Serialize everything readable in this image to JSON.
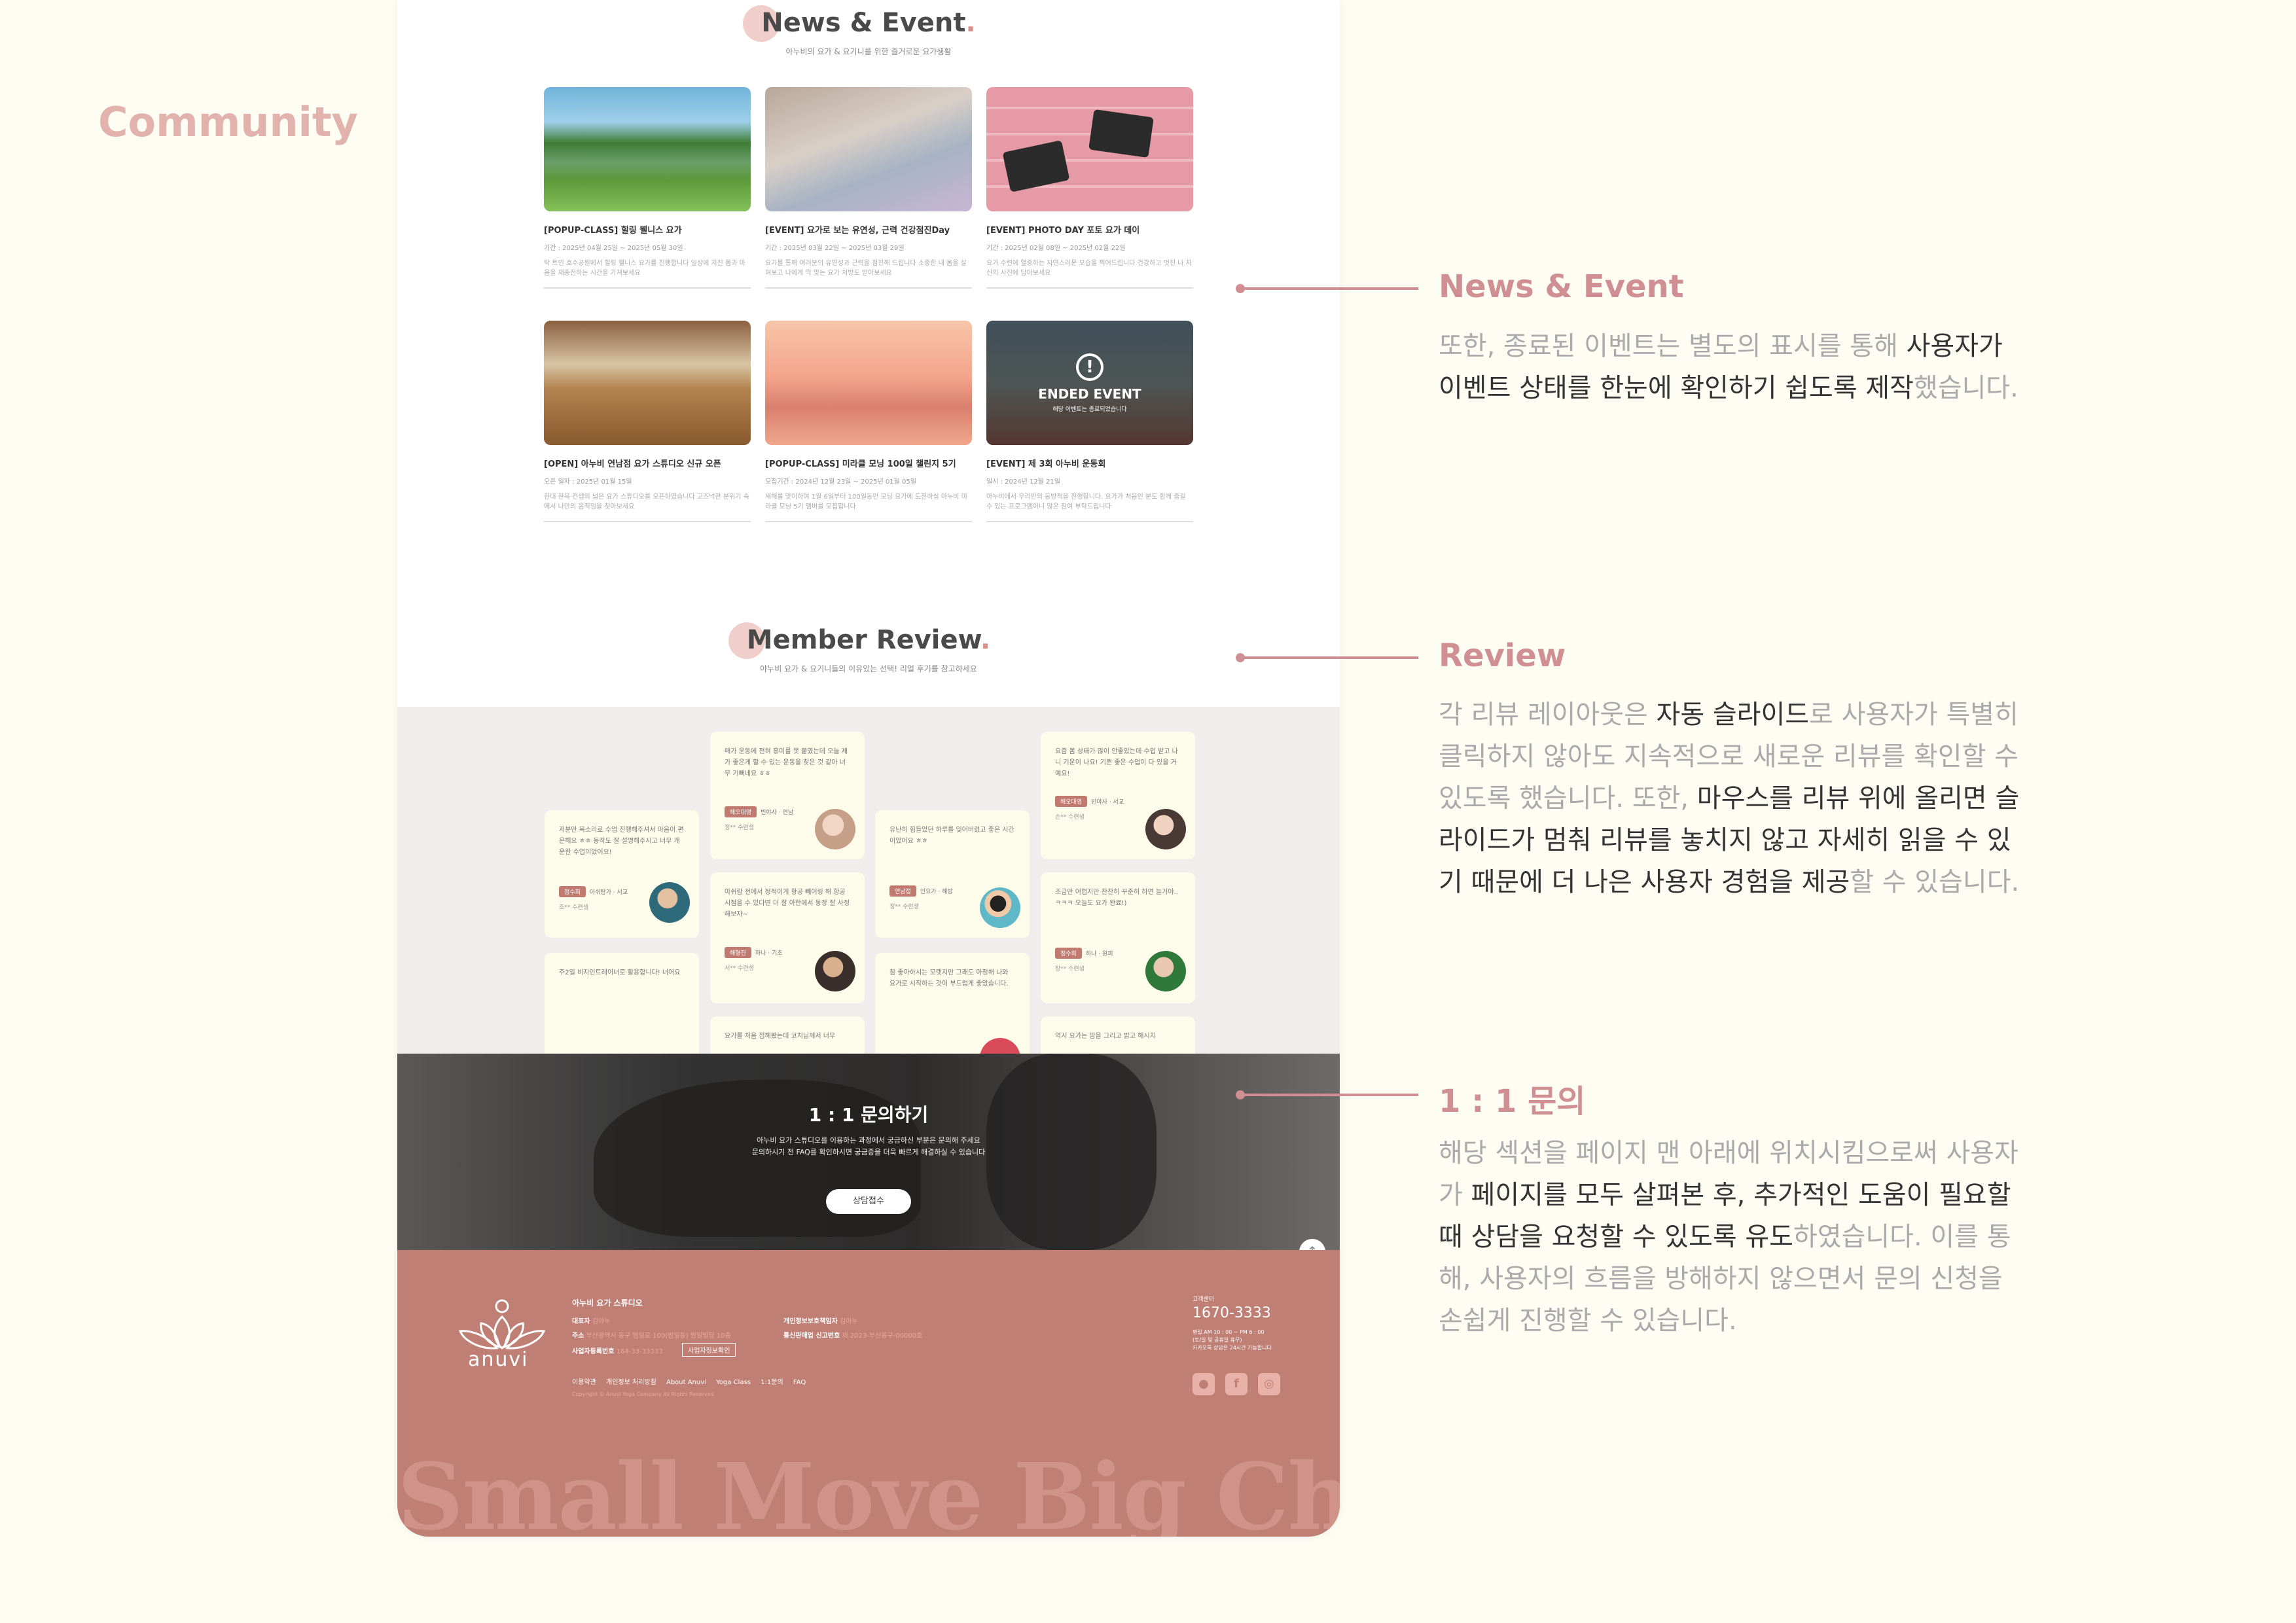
{
  "side_title": "Community",
  "news": {
    "title": "News & Event",
    "dot": ".",
    "subtitle": "아누비의 요가 & 요기니를 위한 즐거로운 요가생활",
    "cards": [
      {
        "title": "[POPUP-CLASS] 힐링 웰니스 요가",
        "date": "기간 : 2025년 04월 25일 ~ 2025년 05월 30일",
        "desc": "탁 트인 호수공원에서 힐링 웰니스 요가를 진행합니다 일상에 지친 몸과 마음을 재충전하는 시간을 가져보세요"
      },
      {
        "title": "[EVENT] 요가로 보는 유연성, 근력 건강점진Day",
        "date": "기간 : 2025년 03월 22일 ~ 2025년 03월 29일",
        "desc": "요가를 통해 여러분의 유연성과 근력을 점진해 드립니다 소중한 내 몸을 살펴보고 나에게 딱 맞는 요가 처방도 받아보세요"
      },
      {
        "title": "[EVENT] PHOTO DAY 포토 요가 데이",
        "date": "기간 : 2025년 02월 08일 ~ 2025년 02월 22일",
        "desc": "요가 수련에 열중하는 자연스러운 모습을 찍어드립니다 건강하고 멋진 나 자신의 사진에 담아보세요"
      },
      {
        "title": "[OPEN] 아누비 연남점 요가 스튜디오 신규 오픈",
        "date": "오픈 일자 : 2025년 01월 15일",
        "desc": "현대 한옥 컨셉의 넓은 요가 스튜디오를 오픈하였습니다 고즈넉한 분위기 속에서 나만의 움직임을 찾아보세요"
      },
      {
        "title": "[POPUP-CLASS] 미라클 모닝 100일 챌린지 5기",
        "date": "모집기간 : 2024년 12월 23일 ~ 2025년 01월 05일",
        "desc": "새해를 맞이하여 1월 6일부터 100일동안 모닝 요가에 도전하실 아누비 미라클 모닝 5기 멤버를 모집합니다"
      },
      {
        "title": "[EVENT] 제 3회 아누비 운동회",
        "date": "일시 : 2024년 12월 21일",
        "desc": "아누비에서 우리만의 동방적을 진행합니다. 요가가 처음인 분도 함께 즐길 수 있는 프로그램이니 많은 참여 부탁드립니다"
      }
    ],
    "ended_title": "ENDED EVENT",
    "ended_sub": "해당 이벤트는 종료되었습니다"
  },
  "review": {
    "title": "Member Review",
    "dot": ".",
    "subtitle": "아누비 요가 & 요기니들의 이유있는 선택! 리얼 후기를 참고하세요",
    "cards": [
      {
        "text": "저분만 목소리로 수업 진행해주셔서 마음이 편온해요 ㅎㅎ 동작도 잘 설명해주시고 너무 개운한 수업이었어요!",
        "tag": "정수희",
        "meta": "아쉬탕가 · 서교",
        "star": "조** 수련생"
      },
      {
        "text": "주2일 비지인트레이너로 활용합니다! 너어요",
        "tag": "",
        "meta": "",
        "star": ""
      },
      {
        "text": "매가 운동에 전혀 흥미를 못 붙였는데 오늘 제가 좋은게 할 수 있는 운동을 찾은 것 같아 너무 기뻐네요 ㅎㅎ",
        "tag": "해오대영",
        "meta": "빈야사 · 연남",
        "star": "정** 수련생"
      },
      {
        "text": "아쉬람 전에서 정적이게 항공 빼어링 해 항공 시점을 수 있다면 더 잘 아한에서 동장 잘 사정해보자~",
        "tag": "해형진",
        "meta": "하나 · 기초",
        "star": "서** 수련생"
      },
      {
        "text": "요가를 처음 접해봤는데 코치님께서 너무",
        "tag": "",
        "meta": "",
        "star": ""
      },
      {
        "text": "유난히 힘들었던 하루를 잊어버렸고 좋은 시간이었어요 ㅎㅎ",
        "tag": "연남점",
        "meta": "인요가 · 해방",
        "star": "정** 수련생"
      },
      {
        "text": "참 좋아하시는 모랫지만 그래도 아정해 나와 요가로 시작하는 것이 부드럽게 좋았습니다.",
        "tag": "",
        "meta": "",
        "star": ""
      },
      {
        "text": "요즘 몸 상태가 많이 안좋았는데 수업 받고 나니 기운이 나요! 기쁜 좋은 수업이 다 있을 거예요!",
        "tag": "해오대영",
        "meta": "빈야사 · 서교",
        "star": "손** 수련생"
      },
      {
        "text": "조금만 어렵지만 찬찬히 꾸준히 하면 늘거야.. ㅋㅋㅋ 오늘도 요가 완료!)",
        "tag": "정수희",
        "meta": "하나 · 원피",
        "star": "장** 수련생"
      },
      {
        "text": "역시 요가는 땀을 그리고 밝고 해시지",
        "tag": "",
        "meta": "",
        "star": ""
      }
    ]
  },
  "contact": {
    "title": "1 : 1 문의하기",
    "desc1": "아누비 요가 스튜디오를 이용하는 과정에서 궁금하신 부분은 문의해 주세요",
    "desc2": "문의하시기 전 FAQ를 확인하시면 궁금증을 더욱 빠르게 해결하실 수 있습니다",
    "button": "상담접수",
    "top_icon": "↑"
  },
  "footer": {
    "logo": "anuvi",
    "company": "아누비 요가 스튜디오",
    "ceo_label": "대표자",
    "ceo": "김아누",
    "addr_label": "주소",
    "addr": "부산광역시 동구 범일로 100(범일동) 범일빌딩 10층",
    "biz_label": "사업자등록번호",
    "biz": "164-33-33333",
    "biz_btn": "사업자정보확인",
    "privacy_label": "개인정보보호책임자",
    "privacy": "김아누",
    "mail_label": "통신판매업 신고번호",
    "mail": "제 2023-부산동구-00000호",
    "links": [
      "이용약관",
      "개인정보 처리방침",
      "About Anuvi",
      "Yoga Class",
      "1:1문의",
      "FAQ"
    ],
    "copyright": "Copyright © Anuvi Yoga Company All Rights Reserved",
    "cs_label": "고객센터",
    "cs_phone": "1670-3333",
    "cs_hours1": "평일 AM 10 : 00 ~ PM 6 : 00",
    "cs_hours2": "(토/일 및 공휴일 휴무)",
    "cs_hours3": "카카오톡 상담은 24시간 가능합니다",
    "icons": [
      "kakao-icon",
      "facebook-icon",
      "instagram-icon"
    ],
    "slogan": "Small Move Big Change"
  },
  "annotations": [
    {
      "title": "News & Event",
      "body": [
        "또한, 종료된 이벤트는 별도의 표시를 통해 ",
        "사용자가 이벤트 상태를 한눈에 확인하기 쉽도록 제작",
        "했습니다."
      ]
    },
    {
      "title": "Review",
      "body": [
        "각 리뷰 레이아웃은 ",
        "자동 슬라이드",
        "로 사용자가 특별히 클릭하지 않아도 지속적으로 새로운 리뷰를 확인할 수 있도록 했습니다. 또한, ",
        "마우스를 리뷰 위에 올리면 슬라이드가 멈춰 리뷰를 놓치지 않고 자세히 읽을 수 있기 때문에 더 나은 사용자 경험을 제공",
        "할 수 있습니다."
      ]
    },
    {
      "title": "1 : 1 문의",
      "body": [
        "해당 섹션을 페이지 맨 아래에 위치시킴으로써 사용자가 ",
        "페이지를 모두 살펴본 후, 추가적인 도움이 필요할 때 상담을 요청할 수 있도록 유도",
        "하였습니다. 이를 통해, 사용자의 흐름을 방해하지 않으면서 문의 신청을 손쉽게 진행할 수 있습니다."
      ]
    }
  ]
}
